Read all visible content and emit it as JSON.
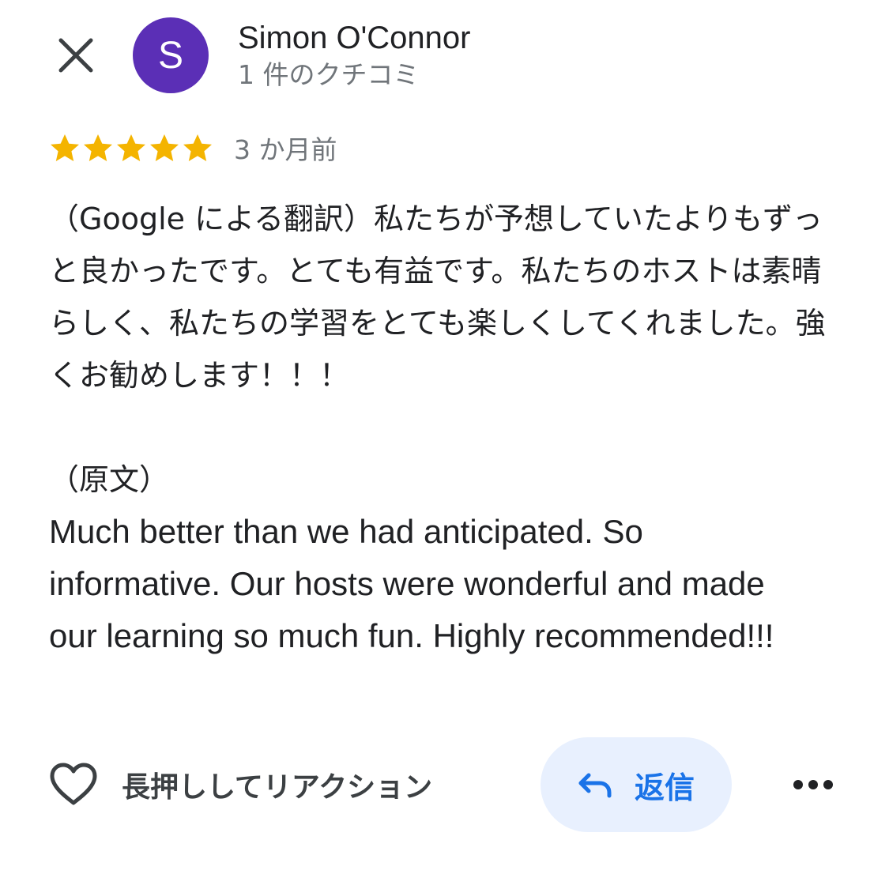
{
  "reviewer": {
    "avatar_initial": "S",
    "avatar_color": "#5b2fb6",
    "name": "Simon O'Connor",
    "review_count": "1 件のクチコミ"
  },
  "review": {
    "rating": 5,
    "max_rating": 5,
    "star_color": "#f4b400",
    "date": "3 か月前",
    "translated_text": "（Google による翻訳）私たちが予想していたよりもずっと良かったです。とても有益です。私たちのホストは素晴らしく、私たちの学習をとても楽しくしてくれました。強くお勧めします！！！",
    "original_label": "（原文）",
    "original_text": "Much better than we had anticipated. So informative. Our hosts were wonderful and made our learning so much fun. Highly recommended!!!"
  },
  "actions": {
    "react_icon": "heart-outline-icon",
    "react_label": "長押ししてリアクション",
    "reply_icon": "reply-arrow-icon",
    "reply_label": "返信",
    "reply_bg_color": "#e8f0fe",
    "reply_text_color": "#1a73e8",
    "more_icon": "more-horizontal-icon",
    "close_icon": "close-icon"
  }
}
